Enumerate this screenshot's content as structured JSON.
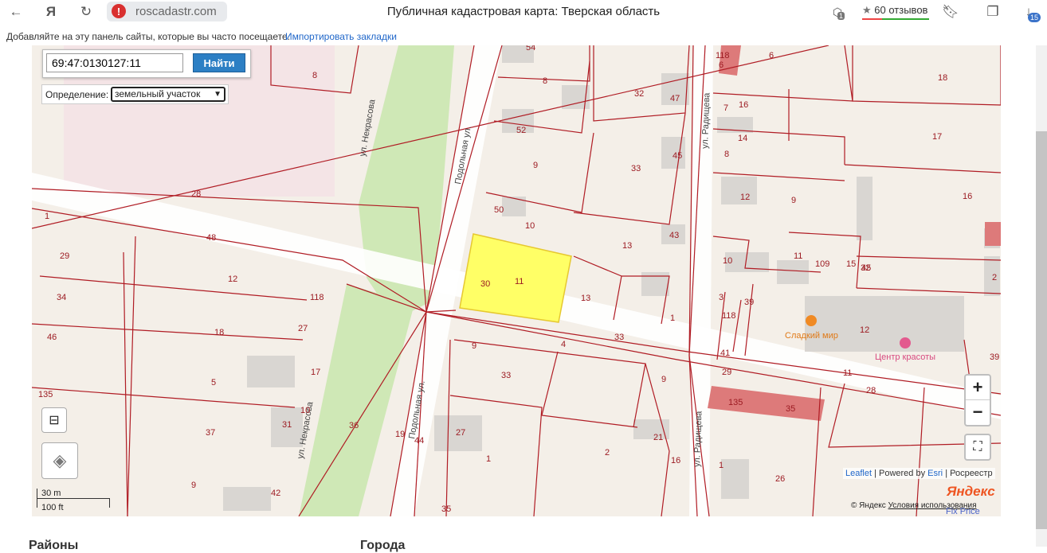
{
  "browser": {
    "domain": "roscadastr.com",
    "page_title": "Публичная кадастровая карта: Тверская область",
    "reviews": "60 отзывов",
    "tab_count": "15",
    "notif_count": "1"
  },
  "bookmarks": {
    "prompt": "Добавляйте на эту панель сайты, которые вы часто посещаете.",
    "import_link": "Импортировать закладки"
  },
  "search": {
    "cadastral_value": "69:47:0130127:11",
    "find_button": "Найти",
    "definition_label": "Определение:",
    "definition_selected": "земельный участок"
  },
  "streets": {
    "nekrasova": "ул. Некрасова",
    "podolnaya": "Подольная ул.",
    "radishcheva": "ул. Радищева"
  },
  "parcel_labels": [
    "54",
    "8",
    "8",
    "32",
    "47",
    "118",
    "6",
    "6",
    "18",
    "52",
    "9",
    "16",
    "7",
    "45",
    "14",
    "33",
    "17",
    "8",
    "50",
    "10",
    "12",
    "9",
    "16",
    "28",
    "1",
    "43",
    "13",
    "10",
    "11",
    "109",
    "15",
    "32",
    "48",
    "11",
    "30",
    "12",
    "45",
    "2",
    "29",
    "13",
    "118",
    "3",
    "34",
    "118",
    "39",
    "12",
    "27",
    "18",
    "33",
    "4",
    "41",
    "46",
    "1",
    "9",
    "33",
    "29",
    "11",
    "39",
    "17",
    "9",
    "28",
    "5",
    "135",
    "135",
    "35",
    "10",
    "31",
    "36",
    "19",
    "44",
    "27",
    "37",
    "21",
    "16",
    "2",
    "1",
    "1",
    "26",
    "9",
    "42",
    "35"
  ],
  "pois": {
    "cafe": "Сладкий мир",
    "beauty": "Центр красоты"
  },
  "map_controls": {
    "zoom_in": "+",
    "zoom_out": "−",
    "scale_metric": "30 m",
    "scale_imperial": "100 ft"
  },
  "attribution": {
    "leaflet": "Leaflet",
    "powered": "| Powered by",
    "esri": "Esri",
    "rosreestr": "| Росреестр",
    "yandex_logo": "Яндекс",
    "copyright": "© Яндекс",
    "terms": "Условия использования",
    "fix_price": "Fix Price"
  },
  "bottom_sections": {
    "left": "Районы",
    "right": "Города"
  },
  "colors": {
    "highlight_parcel": "#ffff66",
    "boundary": "#b01c24",
    "park": "#cde7b0",
    "button": "#2c7fc4"
  }
}
